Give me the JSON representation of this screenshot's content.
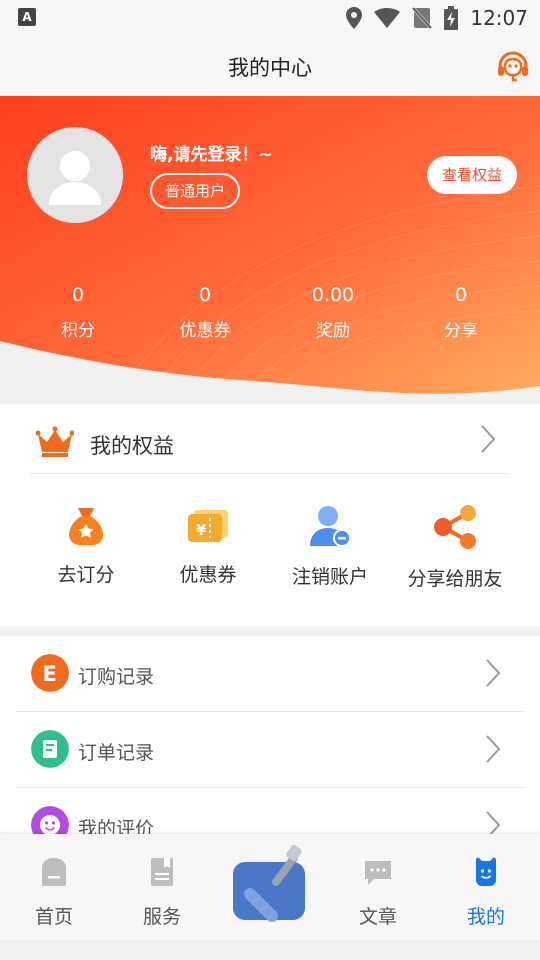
{
  "status_bar": {
    "app_icon_letter": "A",
    "time": "12:07"
  },
  "header": {
    "title": "我的中心",
    "service_icon": "headset-icon"
  },
  "profile": {
    "greeting": "嗨,请先登录！~",
    "user_type": "普通用户",
    "rights_button": "查看权益",
    "stats": [
      {
        "value": "0",
        "label": "积分"
      },
      {
        "value": "0",
        "label": "优惠券"
      },
      {
        "value": "0.00",
        "label": "奖励"
      },
      {
        "value": "0",
        "label": "分享"
      }
    ]
  },
  "rights": {
    "title": "我的权益",
    "items": [
      {
        "label": "去订分",
        "icon": "money-bag-icon"
      },
      {
        "label": "优惠券",
        "icon": "coupon-icon"
      },
      {
        "label": "注销账户",
        "icon": "user-remove-icon"
      },
      {
        "label": "分享给朋友",
        "icon": "share-icon"
      }
    ]
  },
  "menu": {
    "rows": [
      {
        "label": "订购记录",
        "icon": "order-e-icon",
        "color": "#f26a1b"
      },
      {
        "label": "订单记录",
        "icon": "receipt-icon",
        "color": "#2fbf8c"
      },
      {
        "label": "我的评价",
        "icon": "smile-icon",
        "color": "#b24be0"
      }
    ]
  },
  "tabbar": {
    "tabs": [
      {
        "label": "首页",
        "icon": "home-icon"
      },
      {
        "label": "服务",
        "icon": "service-book-icon"
      },
      {
        "label": "文章",
        "icon": "message-icon"
      },
      {
        "label": "我的",
        "icon": "profile-icon"
      }
    ],
    "center_icon": "shovel-icon",
    "active_color": "#1677e8"
  },
  "colors": {
    "hero_start": "#ff4a22",
    "hero_end": "#ffa35e",
    "accent": "#ef4d2c"
  }
}
